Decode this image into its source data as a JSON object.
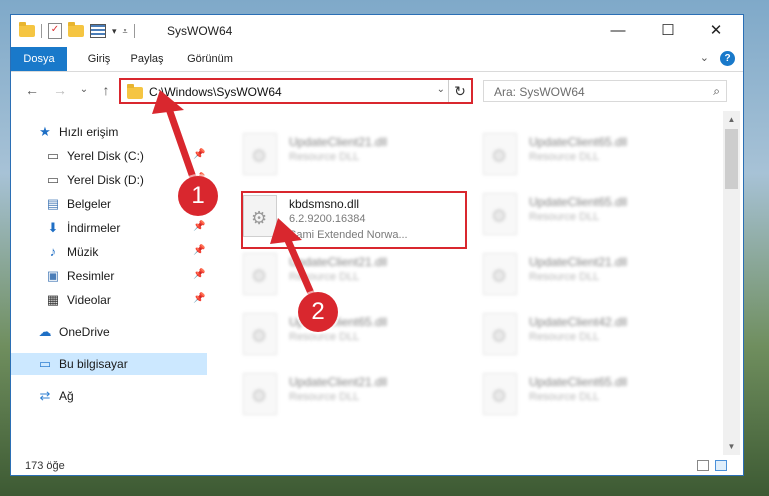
{
  "window": {
    "title": "SysWOW64",
    "minimize_icon": "—",
    "maximize_icon": "☐",
    "close_icon": "✕"
  },
  "ribbon": {
    "tabs": [
      "Dosya",
      "Giriş",
      "Paylaş",
      "Görünüm"
    ],
    "expand_icon": "⌄",
    "help_icon": "?"
  },
  "navigation": {
    "back_icon": "←",
    "forward_icon": "→",
    "recent_icon": "⌄",
    "up_icon": "↑"
  },
  "address_bar": {
    "path": "C:\\Windows\\SysWOW64",
    "dropdown_icon": "⌄",
    "refresh_icon": "↻"
  },
  "search": {
    "placeholder": "Ara: SysWOW64",
    "icon": "⌕"
  },
  "sidebar": {
    "items": [
      {
        "label": "Hızlı erişim",
        "icon": "★"
      },
      {
        "label": "Yerel Disk (C:)",
        "icon": "▭",
        "pinned": true
      },
      {
        "label": "Yerel Disk (D:)",
        "icon": "▭",
        "pinned": true
      },
      {
        "label": "Belgeler",
        "icon": "▤",
        "pinned": true
      },
      {
        "label": "İndirmeler",
        "icon": "⬇",
        "pinned": true
      },
      {
        "label": "Müzik",
        "icon": "♪",
        "pinned": true
      },
      {
        "label": "Resimler",
        "icon": "▣",
        "pinned": true
      },
      {
        "label": "Videolar",
        "icon": "▦",
        "pinned": true
      },
      {
        "label": "OneDrive",
        "icon": "☁"
      },
      {
        "label": "Bu bilgisayar",
        "icon": "▭",
        "selected": true
      },
      {
        "label": "Ağ",
        "icon": "⇄"
      }
    ],
    "pin_icon": "📌"
  },
  "files": {
    "highlighted": {
      "name": "kbdsmsno.dll",
      "version": "6.2.9200.16384",
      "description": "Sami Extended Norwa..."
    },
    "blurred": [
      {
        "name": "UpdateClient21.dll",
        "sub": "Resource DLL"
      },
      {
        "name": "UpdateClient65.dll",
        "sub": "Resource DLL"
      },
      {
        "name": "UpdateClient65.dll",
        "sub": "Resource DLL"
      },
      {
        "name": "UpdateClient21.dll",
        "sub": "Resource DLL"
      },
      {
        "name": "UpdateClient21.dll",
        "sub": "Resource DLL"
      },
      {
        "name": "UpdateClient65.dll",
        "sub": "Resource DLL"
      },
      {
        "name": "UpdateClient42.dll",
        "sub": "Resource DLL"
      },
      {
        "name": "UpdateClient21.dll",
        "sub": "Resource DLL"
      },
      {
        "name": "UpdateClient65.dll",
        "sub": "Resource DLL"
      }
    ]
  },
  "status_bar": {
    "item_count": "173 öğe"
  },
  "annotations": {
    "step1": "1",
    "step2": "2",
    "color": "#d9272e"
  }
}
